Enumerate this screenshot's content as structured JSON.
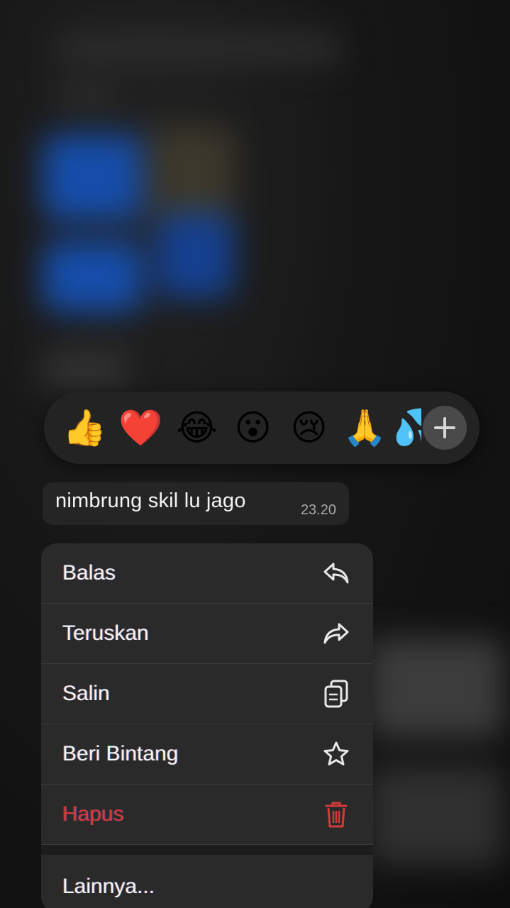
{
  "reactions": {
    "items": [
      "👍",
      "❤️",
      "😂",
      "😮",
      "😢",
      "🙏",
      "💦"
    ],
    "more_icon": "plus-icon"
  },
  "message": {
    "text": "nimbrung skil lu jago",
    "time": "23.20"
  },
  "menu": {
    "items": [
      {
        "label": "Balas",
        "icon": "reply-icon"
      },
      {
        "label": "Teruskan",
        "icon": "forward-icon"
      },
      {
        "label": "Salin",
        "icon": "copy-icon"
      },
      {
        "label": "Beri Bintang",
        "icon": "star-icon"
      },
      {
        "label": "Hapus",
        "icon": "trash-icon"
      }
    ],
    "more_label": "Lainnya..."
  },
  "colors": {
    "danger": "#d33a3a",
    "menu_bg": "#2a2a2a",
    "bar_bg": "#232323"
  }
}
